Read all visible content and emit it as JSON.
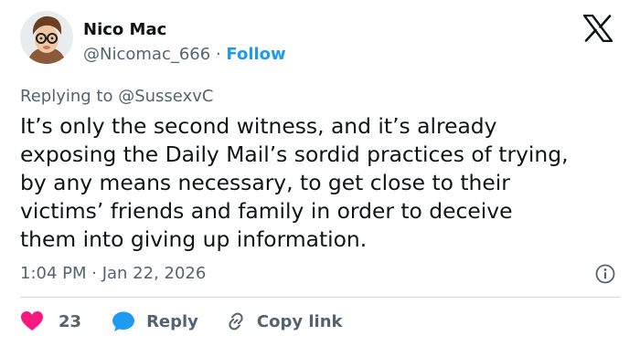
{
  "author": {
    "name": "Nico Mac",
    "handle": "@Nicomac_666",
    "separator": "·",
    "follow_label": "Follow",
    "avatar": "profile-photo"
  },
  "brand": {
    "logo": "x-logo-icon"
  },
  "tweet": {
    "replying_prefix": "Replying to",
    "replying_handle": "@SussexvC",
    "text": "It’s only the second witness, and it’s already\nexposing the Daily Mail’s sordid practices of trying,\nby any means necessary, to get close to their\nvictims’ friends and family in order to deceive\nthem into giving up information.",
    "timestamp": "1:04 PM · Jan 22, 2026"
  },
  "actions": {
    "like_count": "23",
    "reply_label": "Reply",
    "copy_link_label": "Copy link"
  },
  "colors": {
    "text": "#0f1419",
    "secondary": "#536471",
    "link": "#1d9bf0",
    "like": "#f91880",
    "divider": "#cfd9de"
  }
}
